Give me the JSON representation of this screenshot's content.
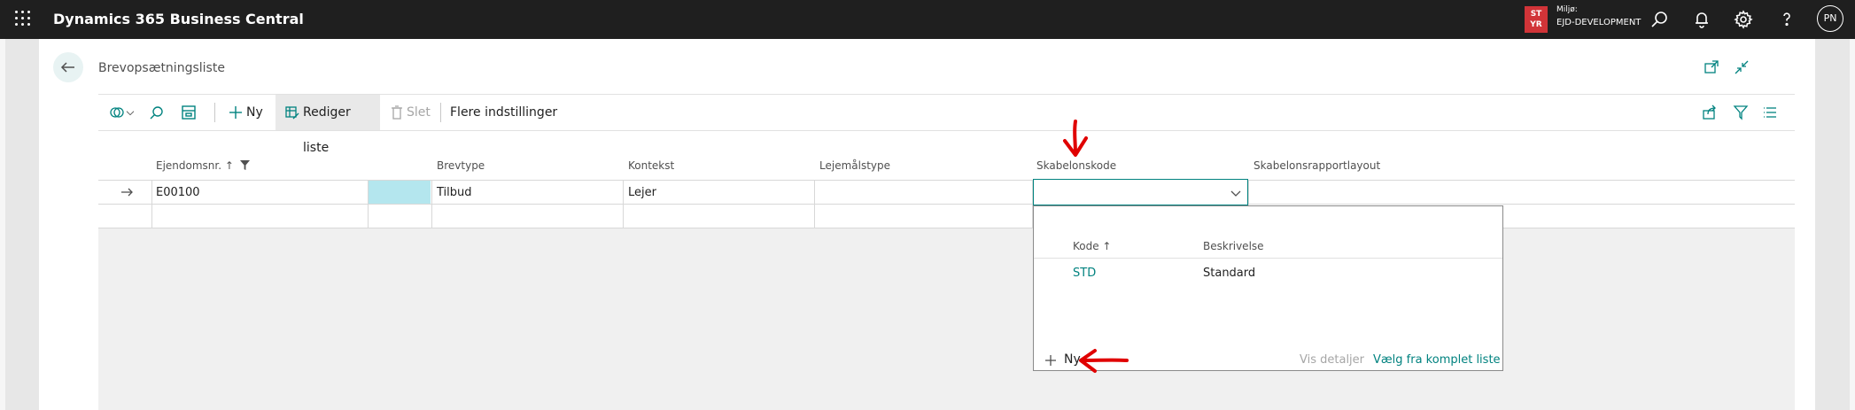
{
  "topbar": {
    "app_title": "Dynamics 365 Business Central",
    "env_badge_line1": "ST",
    "env_badge_line2": "YR",
    "env_label": "Miljø:",
    "env_name": "EJD-DEVELOPMENT",
    "avatar_initials": "PN",
    "icons": [
      "waffle-icon",
      "search-icon",
      "bell-icon",
      "gear-icon",
      "help-icon"
    ]
  },
  "page": {
    "title": "Brevopsætningsliste"
  },
  "actionbar": {
    "new_label": "Ny",
    "edit_list_label": "Rediger liste",
    "delete_label": "Slet",
    "more_options_label": "Flere indstillinger"
  },
  "grid": {
    "columns": [
      "Ejendomsnr. ↑",
      "Brevtype",
      "Kontekst",
      "Lejemålstype",
      "Skabelonskode",
      "Skabelonsrapportlayout"
    ],
    "rows": [
      {
        "ejendomsnr": "E00100",
        "brevtype": "Tilbud",
        "kontekst": "Lejer",
        "lejemaalstype": "",
        "skabelonskode": "",
        "layout": ""
      },
      {
        "ejendomsnr": "",
        "brevtype": "",
        "kontekst": "",
        "lejemaalstype": "",
        "skabelonskode": "",
        "layout": ""
      }
    ]
  },
  "lookup": {
    "col_code": "Kode ↑",
    "col_desc": "Beskrivelse",
    "items": [
      {
        "code": "STD",
        "description": "Standard"
      }
    ],
    "new_label": "Ny",
    "view_details_label": "Vis detaljer",
    "full_list_label": "Vælg fra komplet liste"
  },
  "colors": {
    "accent": "#00827f",
    "topbar": "#1f1f1f",
    "badge": "#d13438",
    "annotation": "#e00000"
  }
}
